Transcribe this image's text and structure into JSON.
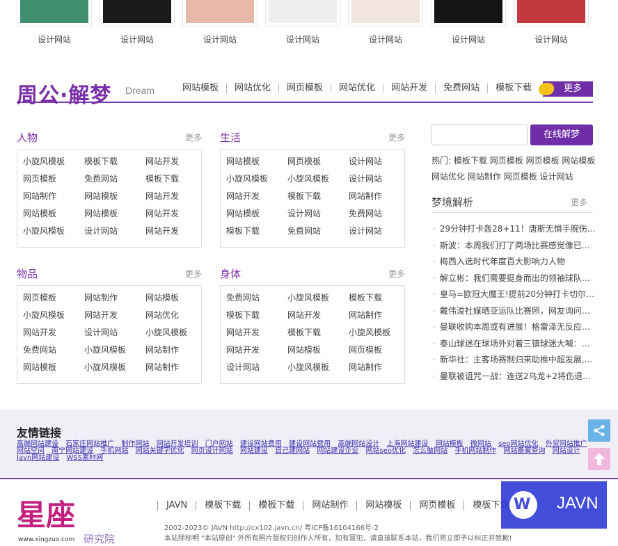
{
  "thumbs": [
    {
      "caption": "设计网站",
      "color": "#3f8f70"
    },
    {
      "caption": "设计网站",
      "color": "#1a1a1a"
    },
    {
      "caption": "设计网站",
      "color": "#e8b9a8"
    },
    {
      "caption": "设计网站",
      "color": "#eeeeee"
    },
    {
      "caption": "设计网站",
      "color": "#f2e6de"
    },
    {
      "caption": "设计网站",
      "color": "#151515"
    },
    {
      "caption": "设计网站",
      "color": "#c23a3f"
    }
  ],
  "section": {
    "title": "周公·解梦",
    "subtitle": "Dream",
    "nav": [
      "网站模板",
      "网站优化",
      "网页模板",
      "网站优化",
      "网站开发",
      "免费网站",
      "模板下载"
    ],
    "more": "更多",
    "accent": "#6f2da8"
  },
  "categories": [
    {
      "title": "人物",
      "more": "更多",
      "items": [
        "小旋风模板",
        "模板下载",
        "网站开发",
        "网页模板",
        "免费网站",
        "模板下载",
        "网站制作",
        "网站模板",
        "网站开发",
        "网站模板",
        "网站模板",
        "网站开发",
        "小旋风模板",
        "设计网站",
        "网站开发"
      ]
    },
    {
      "title": "生活",
      "more": "更多",
      "items": [
        "网站模板",
        "网页模板",
        "设计网站",
        "小旋风模板",
        "小旋风模板",
        "设计网站",
        "网站开发",
        "模板下载",
        "网站制作",
        "网站模板",
        "设计网站",
        "免费网站",
        "模板下载",
        "免费网站",
        "设计网站"
      ]
    },
    {
      "title": "物品",
      "more": "更多",
      "items": [
        "网页模板",
        "网站制作",
        "网站模板",
        "小旋风模板",
        "网站开发",
        "网站优化",
        "网站开发",
        "设计网站",
        "小旋风模板",
        "免费网站",
        "小旋风模板",
        "网站制作",
        "网站模板",
        "小旋风模板",
        "网站制作"
      ]
    },
    {
      "title": "身体",
      "more": "更多",
      "items": [
        "免费网站",
        "小旋风模板",
        "模板下载",
        "模板下载",
        "网站开发",
        "网站制作",
        "网站开发",
        "模板下载",
        "小旋风模板",
        "网站开发",
        "网站模板",
        "网页模板",
        "设计网站",
        "小旋风模板",
        "网站制作"
      ]
    }
  ],
  "search": {
    "button": "在线解梦",
    "placeholder": ""
  },
  "hot": {
    "label": "热门:",
    "tags": [
      "模板下载",
      "网页模板",
      "网页模板",
      "网站模板",
      "网站优化",
      "网站制作",
      "网页模板",
      "设计网站"
    ]
  },
  "dream": {
    "title": "梦境解析",
    "more": "更多",
    "items": [
      "29分钟打卡轰28+11！唐斯无惧手腕伤...",
      "斯波：本周我们打了两场比赛感觉像已经...",
      "梅西入选时代年度百大影响力人物",
      "解立彬：我们需要挺身而出的领袖球队中...",
      "皇马=欧冠大魔王!提前20分钟打卡切尔西...",
      "戴伟浚社媒晒亚运队比赛照，网友询问：...",
      "曼联收购本周或有进展！格雷泽无反应令...",
      "泰山球迷在球场外对着三镇球迷大喊：武...",
      "新华社：主客场赛制归来助推中超发展,...",
      "曼联被诅咒一战：连送2乌龙+2将伤退队..."
    ]
  },
  "friend_links": {
    "title": "友情链接",
    "items": [
      "高端网站建设",
      "石家庄网站推广",
      "制作网站",
      "网站开发培训",
      "门户网站",
      "建设网站费用",
      "建设网站费用",
      "高端网站设计",
      "上海网站建设",
      "网站模板",
      "微网站",
      "seo网站优化",
      "外贸网站推广",
      "网站空间",
      "南宁网站建设",
      "手机网站",
      "网站关键字优化",
      "网页设计网站",
      "网站建设",
      "自己建网站",
      "网站建设企业",
      "网站seo优化",
      "怎么做网站",
      "手机网站制作",
      "网站备案查询",
      "网站设计",
      "Javn网站建设",
      "WSS素材网"
    ]
  },
  "footer": {
    "logo_text": "星座",
    "logo_url": "www.xingzuo.com",
    "logo_sub": "研究院",
    "nav": [
      "JAVN",
      "模板下载",
      "模板下载",
      "网站制作",
      "网站模板",
      "网页模板",
      "模板下载"
    ],
    "copyright": "2002-2023© JAVN http://cx102.javn.cn/ 粤ICP备16104166号-2",
    "notice": "本站除标明 \"本站原创\" 外所有照片版权归创作人所有，如有冒犯，请直接联系本站，我们将立即予以纠正并致歉!"
  },
  "watermark": {
    "text": "JAVN",
    "mark": "W"
  }
}
